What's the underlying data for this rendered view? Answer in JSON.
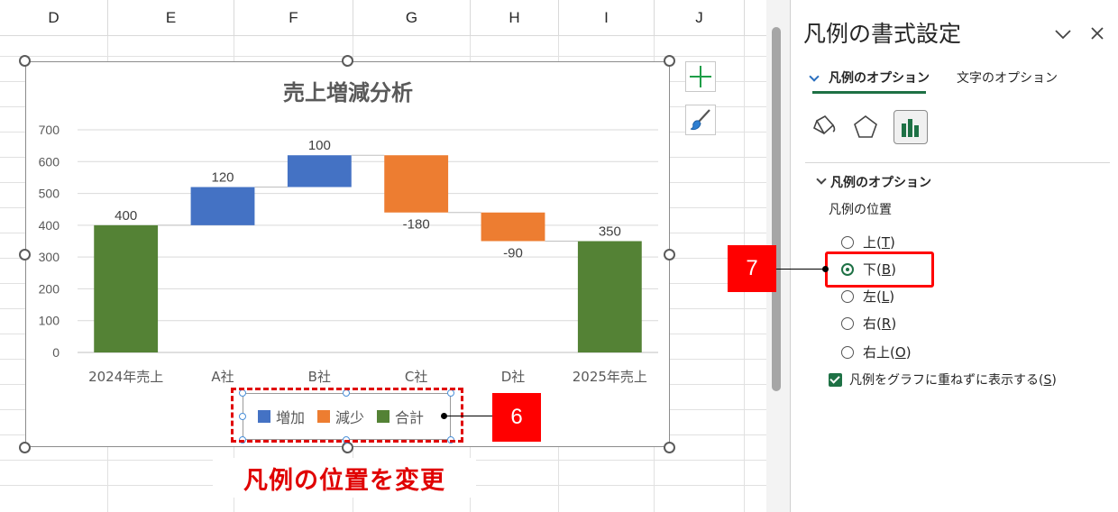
{
  "columns": [
    "D",
    "E",
    "F",
    "G",
    "H",
    "I",
    "J"
  ],
  "chart": {
    "title": "売上増減分析",
    "legend": [
      {
        "label": "増加",
        "color": "#4472C4"
      },
      {
        "label": "減少",
        "color": "#ED7D31"
      },
      {
        "label": "合計",
        "color": "#548235"
      }
    ]
  },
  "chart_data": {
    "type": "bar",
    "title": "売上増減分析",
    "categories": [
      "2024年売上",
      "A社",
      "B社",
      "C社",
      "D社",
      "2025年売上"
    ],
    "bars": [
      {
        "category": "2024年売上",
        "base": 0,
        "top": 400,
        "label": "400",
        "kind": "total"
      },
      {
        "category": "A社",
        "base": 400,
        "top": 520,
        "label": "120",
        "kind": "increase"
      },
      {
        "category": "B社",
        "base": 520,
        "top": 620,
        "label": "100",
        "kind": "increase"
      },
      {
        "category": "C社",
        "base": 440,
        "top": 620,
        "label": "-180",
        "kind": "decrease"
      },
      {
        "category": "D社",
        "base": 350,
        "top": 440,
        "label": "-90",
        "kind": "decrease"
      },
      {
        "category": "2025年売上",
        "base": 0,
        "top": 350,
        "label": "350",
        "kind": "total"
      }
    ],
    "y_ticks": [
      "0",
      "100",
      "200",
      "300",
      "400",
      "500",
      "600",
      "700"
    ],
    "ylim": [
      0,
      700
    ],
    "legend_position": "bottom",
    "colors": {
      "increase": "#4472C4",
      "decrease": "#ED7D31",
      "total": "#548235"
    }
  },
  "annotations": {
    "callout_legend": "6",
    "callout_option": "7",
    "change_position_label": "凡例の位置を変更"
  },
  "pane": {
    "title": "凡例の書式設定",
    "tabs": {
      "legend_options": "凡例のオプション",
      "text_options": "文字のオプション"
    },
    "section_title": "凡例のオプション",
    "position_label": "凡例の位置",
    "positions": [
      {
        "label": "上",
        "key": "T",
        "selected": false
      },
      {
        "label": "下",
        "key": "B",
        "selected": true
      },
      {
        "label": "左",
        "key": "L",
        "selected": false
      },
      {
        "label": "右",
        "key": "R",
        "selected": false
      },
      {
        "label": "右上",
        "key": "O",
        "selected": false
      }
    ],
    "overlap_checkbox": {
      "label": "凡例をグラフに重ねずに表示する",
      "key": "S",
      "checked": true
    },
    "accent_color": "#1E7145"
  }
}
